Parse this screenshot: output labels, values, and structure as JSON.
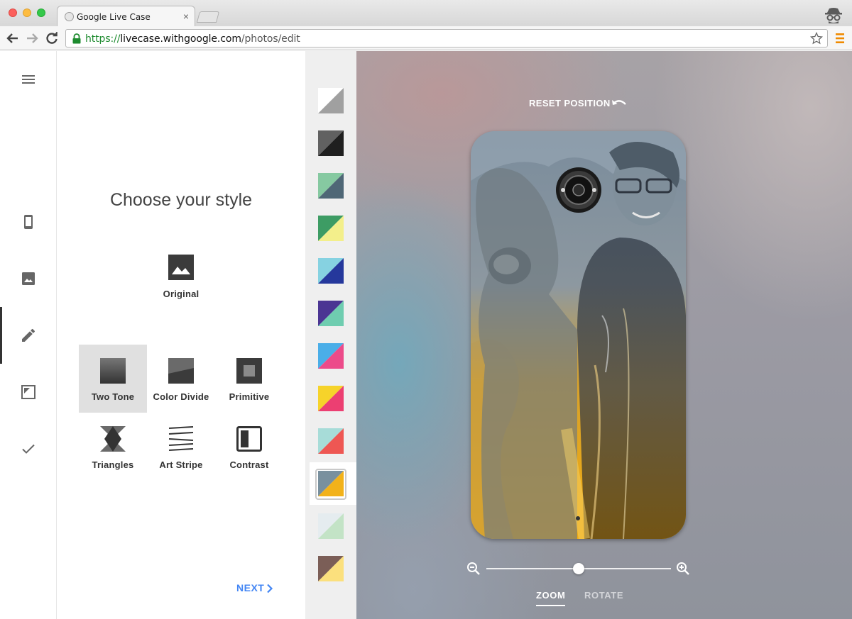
{
  "browser": {
    "tab_title": "Google Live Case",
    "tab_close": "×",
    "url_protocol": "https://",
    "url_host": "livecase.withgoogle.com",
    "url_path": "/photos/edit"
  },
  "left_nav": {
    "items": [
      {
        "icon": "menu-icon"
      },
      {
        "icon": "phone-icon"
      },
      {
        "icon": "image-icon"
      },
      {
        "icon": "pencil-icon",
        "active": true
      },
      {
        "icon": "frame-icon"
      },
      {
        "icon": "check-icon"
      }
    ]
  },
  "style_panel": {
    "title": "Choose your style",
    "original_label": "Original",
    "styles": [
      {
        "label": "Two Tone",
        "selected": true
      },
      {
        "label": "Color Divide"
      },
      {
        "label": "Primitive"
      },
      {
        "label": "Triangles"
      },
      {
        "label": "Art Stripe"
      },
      {
        "label": "Contrast"
      }
    ],
    "next_label": "NEXT"
  },
  "swatches": [
    {
      "colors": [
        "#ffffff",
        "#a0a0a0"
      ]
    },
    {
      "colors": [
        "#616161",
        "#1f1f1f"
      ]
    },
    {
      "colors": [
        "#86c9a1",
        "#4f6776"
      ]
    },
    {
      "colors": [
        "#3d9c64",
        "#f3ef8b"
      ]
    },
    {
      "colors": [
        "#86d2e1",
        "#25389c"
      ]
    },
    {
      "colors": [
        "#4b3593",
        "#6fcdb0"
      ]
    },
    {
      "colors": [
        "#4aaee8",
        "#ec4b8a"
      ]
    },
    {
      "colors": [
        "#f6d32a",
        "#ec3f72"
      ]
    },
    {
      "colors": [
        "#a7dcd8",
        "#ee5753"
      ]
    },
    {
      "colors": [
        "#79909e",
        "#f2b21a"
      ],
      "selected": true
    },
    {
      "colors": [
        "#e5ecef",
        "#c3e3c6"
      ]
    },
    {
      "colors": [
        "#7b5e57",
        "#fbe07d"
      ]
    }
  ],
  "preview": {
    "reset_label": "RESET POSITION",
    "zoom_tab": "ZOOM",
    "rotate_tab": "ROTATE",
    "zoom_level": 0.5,
    "tone_colors": {
      "top": "#7a8c9c",
      "bottom": "#f1ab10"
    }
  }
}
